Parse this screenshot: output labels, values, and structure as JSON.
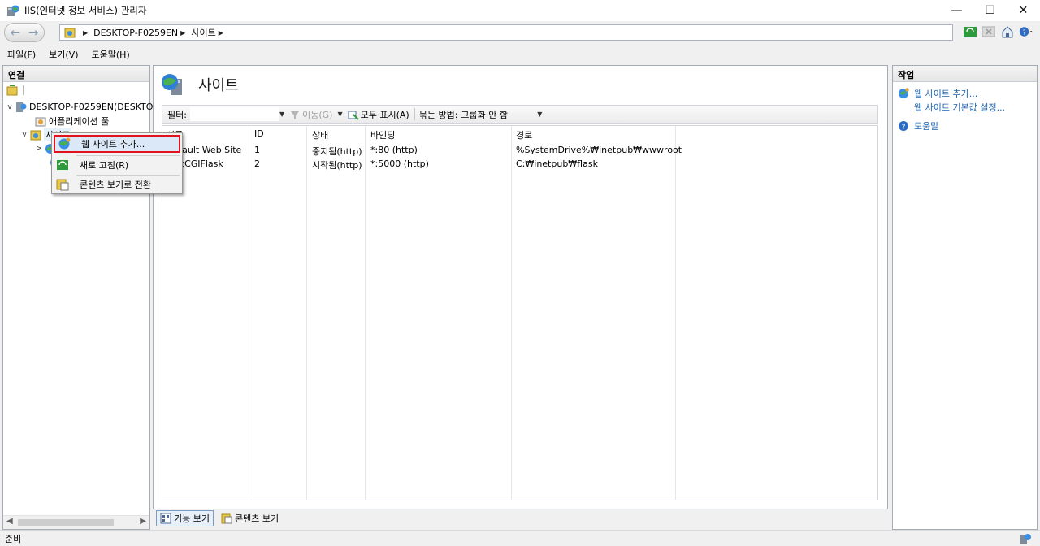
{
  "window": {
    "title": "IIS(인터넷 정보 서비스) 관리자",
    "minimize": "—",
    "maximize": "☐",
    "close": "✕"
  },
  "address": {
    "crumbs": [
      "DESKTOP-F0259EN",
      "사이트"
    ],
    "back": "←",
    "forward": "→"
  },
  "menu": [
    "파일(F)",
    "보기(V)",
    "도움말(H)"
  ],
  "connections": {
    "header": "연결",
    "tree": [
      {
        "label": "DESKTOP-F0259EN(DESKTOI",
        "expander": "v"
      },
      {
        "label": "애플리케이션 풀",
        "expander": ""
      },
      {
        "label": "사이트",
        "expander": "v"
      },
      {
        "label": "",
        "expander": ">"
      },
      {
        "label": "",
        "expander": ""
      }
    ]
  },
  "main": {
    "title": "사이트",
    "filter": {
      "label": "필터:",
      "go_label": "이동(G)",
      "show_all_label": "모두 표시(A)",
      "group_label": "묶는 방법:",
      "group_value": "그룹화 안 함"
    },
    "columns": [
      "이름",
      "ID",
      "상태",
      "바인딩",
      "경로"
    ],
    "rows": [
      {
        "name": "Default Web Site",
        "id": "1",
        "status": "중지됨(http)",
        "binding": "*:80 (http)",
        "path": "%SystemDrive%₩inetpub₩wwwroot"
      },
      {
        "name": "FastCGIFlask",
        "id": "2",
        "status": "시작됨(http)",
        "binding": "*:5000 (http)",
        "path": "C:₩inetpub₩flask"
      }
    ],
    "tabs": [
      "기능 보기",
      "콘텐츠 보기"
    ]
  },
  "actions": {
    "header": "작업",
    "items": [
      "웹 사이트 추가...",
      "웹 사이트 기본값 설정...",
      "도움말"
    ]
  },
  "context_menu": [
    "웹 사이트 추가...",
    "새로 고침(R)",
    "콘텐츠 보기로 전환"
  ],
  "status": {
    "text": "준비"
  },
  "colors": {
    "link": "#1c63b0",
    "highlight_border": "#e0121b",
    "selection": "#dbe8f7"
  }
}
